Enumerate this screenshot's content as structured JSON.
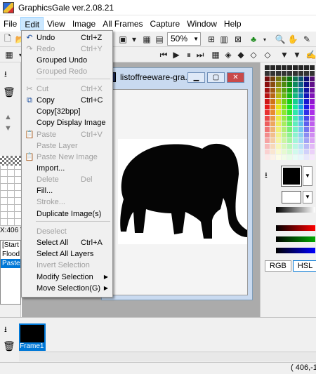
{
  "window": {
    "title": "GraphicsGale ver.2.08.21"
  },
  "menubar": [
    "File",
    "Edit",
    "View",
    "Image",
    "All Frames",
    "Capture",
    "Window",
    "Help"
  ],
  "toolbar": {
    "zoom": "50%"
  },
  "left_panel": {
    "coords": "X:406 Y",
    "history": [
      "[Start E",
      "Flood F",
      "Paste/"
    ]
  },
  "image_window": {
    "title": "listoffreeware-gra..."
  },
  "edit_menu": [
    {
      "label": "Undo",
      "shortcut": "Ctrl+Z",
      "enabled": true,
      "icon": "undo-icon"
    },
    {
      "label": "Redo",
      "shortcut": "Ctrl+Y",
      "enabled": false,
      "icon": "redo-icon"
    },
    {
      "label": "Grouped Undo",
      "shortcut": "",
      "enabled": true,
      "icon": ""
    },
    {
      "label": "Grouped Redo",
      "shortcut": "",
      "enabled": false,
      "icon": ""
    },
    {
      "label": "Cut",
      "shortcut": "Ctrl+X",
      "enabled": false,
      "icon": "cut-icon"
    },
    {
      "label": "Copy",
      "shortcut": "Ctrl+C",
      "enabled": true,
      "icon": "copy-icon"
    },
    {
      "label": "Copy[32bpp]",
      "shortcut": "",
      "enabled": true,
      "icon": ""
    },
    {
      "label": "Copy Display Image",
      "shortcut": "",
      "enabled": true,
      "icon": ""
    },
    {
      "label": "Paste",
      "shortcut": "Ctrl+V",
      "enabled": false,
      "icon": "paste-icon"
    },
    {
      "label": "Paste Layer",
      "shortcut": "",
      "enabled": false,
      "icon": ""
    },
    {
      "label": "Paste New Image",
      "shortcut": "",
      "enabled": false,
      "icon": "paste-new-image-icon"
    },
    {
      "label": "Import...",
      "shortcut": "",
      "enabled": true,
      "icon": ""
    },
    {
      "label": "Delete",
      "shortcut": "Del",
      "enabled": false,
      "icon": ""
    },
    {
      "label": "Fill...",
      "shortcut": "",
      "enabled": true,
      "icon": ""
    },
    {
      "label": "Stroke...",
      "shortcut": "",
      "enabled": false,
      "icon": ""
    },
    {
      "label": "Duplicate Image(s)",
      "shortcut": "",
      "enabled": true,
      "icon": ""
    },
    {
      "label": "Deselect",
      "shortcut": "",
      "enabled": false,
      "icon": ""
    },
    {
      "label": "Select All",
      "shortcut": "Ctrl+A",
      "enabled": true,
      "icon": ""
    },
    {
      "label": "Select All Layers",
      "shortcut": "",
      "enabled": true,
      "icon": ""
    },
    {
      "label": "Invert Selection",
      "shortcut": "",
      "enabled": false,
      "icon": ""
    },
    {
      "label": "Modify Selection",
      "shortcut": "",
      "enabled": true,
      "icon": "",
      "submenu": true
    },
    {
      "label": "Move Selection(G)",
      "shortcut": "",
      "enabled": true,
      "icon": "",
      "submenu": true
    }
  ],
  "palette_panel": {
    "tabs": [
      "RGB",
      "HSL"
    ]
  },
  "frames": {
    "frame_label": "Frame1"
  },
  "status": {
    "coords": "( 406,-1"
  }
}
